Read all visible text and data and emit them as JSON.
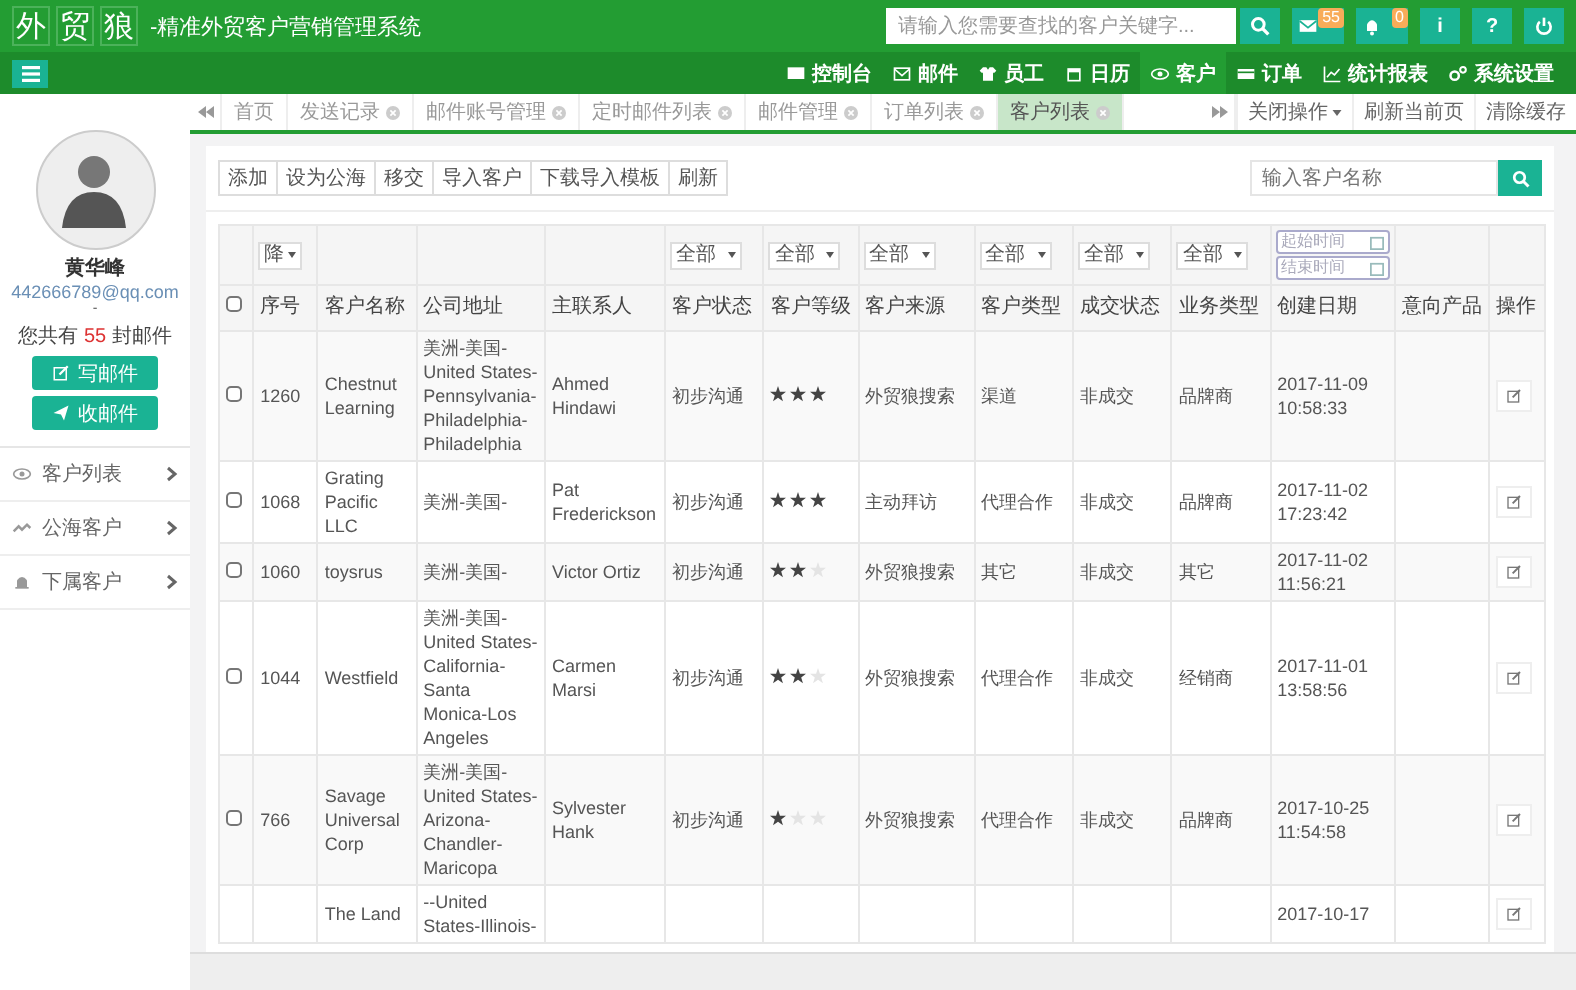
{
  "header": {
    "logo": [
      "外",
      "贸",
      "狼"
    ],
    "subtitle": "-精准外贸客户营销管理系统",
    "search": {
      "placeholder": "请输入您需要查找的客户关键字..."
    },
    "mail_badge": "55",
    "bell_badge": "0",
    "info": "i",
    "help": "?"
  },
  "nav": [
    {
      "label": "控制台",
      "selected": false
    },
    {
      "label": "邮件",
      "selected": false
    },
    {
      "label": "员工",
      "selected": false
    },
    {
      "label": "日历",
      "selected": false
    },
    {
      "label": "客户",
      "selected": true
    },
    {
      "label": "订单",
      "selected": false
    },
    {
      "label": "统计报表",
      "selected": false
    },
    {
      "label": "系统设置",
      "selected": false
    }
  ],
  "sidebar": {
    "user": "黄华峰",
    "email": "442666789@qq.com",
    "dash": "-",
    "mail_prefix": "您共有",
    "mail_count": "55",
    "mail_suffix": "封邮件",
    "buttons": [
      "写邮件",
      "收邮件"
    ],
    "items": [
      {
        "label": "客户列表"
      },
      {
        "label": "公海客户"
      },
      {
        "label": "下属客户"
      }
    ]
  },
  "tabs": [
    {
      "label": "首页",
      "closable": false,
      "selected": false
    },
    {
      "label": "发送记录",
      "closable": true,
      "selected": false
    },
    {
      "label": "邮件账号管理",
      "closable": true,
      "selected": false
    },
    {
      "label": "定时邮件列表",
      "closable": true,
      "selected": false
    },
    {
      "label": "邮件管理",
      "closable": true,
      "selected": false
    },
    {
      "label": "订单列表",
      "closable": true,
      "selected": false
    },
    {
      "label": "客户列表",
      "closable": true,
      "selected": true
    }
  ],
  "tab_actions": [
    "关闭操作",
    "刷新当前页",
    "清除缓存"
  ],
  "toolbar": [
    "添加",
    "设为公海",
    "移交",
    "导入客户",
    "下载导入模板",
    "刷新"
  ],
  "customer_search": {
    "placeholder": "输入客户名称"
  },
  "filters": {
    "sort": "降",
    "selects": [
      "全部",
      "全部",
      "全部",
      "全部",
      "全部",
      "全部"
    ],
    "date_from": "起始时间",
    "date_to": "结束时间"
  },
  "table": {
    "header_checked": false,
    "columns": [
      "序号",
      "客户名称",
      "公司地址",
      "主联系人",
      "客户状态",
      "客户等级",
      "客户来源",
      "客户类型",
      "成交状态",
      "业务类型",
      "创建日期",
      "意向产品",
      "操作"
    ],
    "rows": [
      {
        "checked": false,
        "id": "1260",
        "name": "Chestnut Learning",
        "address": "美洲-美国-United States-Pennsylvania-Philadelphia-Philadelphia",
        "contact": "Ahmed Hindawi",
        "status": "初步沟通",
        "stars": 3,
        "source": "外贸狼搜索",
        "type": "渠道",
        "deal": "非成交",
        "business": "品牌商",
        "created": "2017-11-09 10:58:33"
      },
      {
        "checked": false,
        "id": "1068",
        "name": "Grating Pacific LLC",
        "address": "美洲-美国-",
        "contact": "Pat Frederickson",
        "status": "初步沟通",
        "stars": 3,
        "source": "主动拜访",
        "type": "代理合作",
        "deal": "非成交",
        "business": "品牌商",
        "created": "2017-11-02 17:23:42"
      },
      {
        "checked": false,
        "id": "1060",
        "name": "toysrus",
        "address": "美洲-美国-",
        "contact": "Victor Ortiz",
        "status": "初步沟通",
        "stars": 2,
        "source": "外贸狼搜索",
        "type": "其它",
        "deal": "非成交",
        "business": "其它",
        "created": "2017-11-02 11:56:21"
      },
      {
        "checked": false,
        "id": "1044",
        "name": "Westfield",
        "address": "美洲-美国-United States-California-Santa Monica-Los Angeles",
        "contact": "Carmen Marsi",
        "status": "初步沟通",
        "stars": 2,
        "source": "外贸狼搜索",
        "type": "代理合作",
        "deal": "非成交",
        "business": "经销商",
        "created": "2017-11-01 13:58:56"
      },
      {
        "checked": false,
        "id": "766",
        "name": "Savage Universal Corp",
        "address": "美洲-美国-United States-Arizona-Chandler-Maricopa",
        "contact": "Sylvester Hank",
        "status": "初步沟通",
        "stars": 1,
        "source": "外贸狼搜索",
        "type": "代理合作",
        "deal": "非成交",
        "business": "品牌商",
        "created": "2017-10-25 11:54:58"
      },
      {
        "name": "The Land",
        "address": "--United States-Illinois-",
        "created": "2017-10-17"
      }
    ]
  }
}
